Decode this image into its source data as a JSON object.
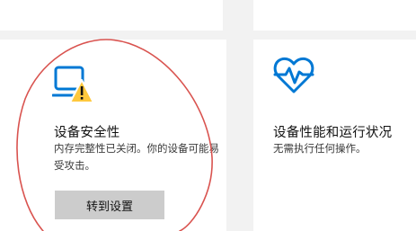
{
  "device_security": {
    "icon": "device-warning-icon",
    "title": "设备安全性",
    "description": "内存完整性已关闭。你的设备可能易受攻击。",
    "button_label": "转到设置"
  },
  "device_health": {
    "icon": "heart-pulse-icon",
    "title": "设备性能和运行状况",
    "description": "无需执行任何操作。"
  },
  "colors": {
    "accent_blue": "#0078d4",
    "warning_yellow": "#ffc83d",
    "annotation_red": "#d9534f"
  }
}
